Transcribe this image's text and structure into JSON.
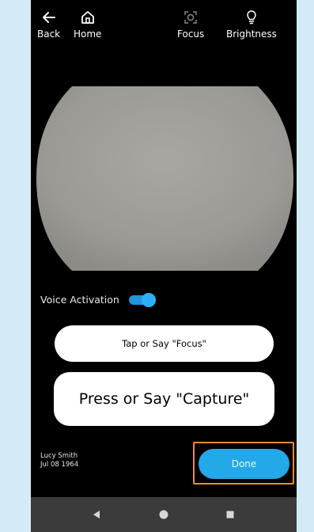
{
  "toolbar": {
    "back_label": "Back",
    "home_label": "Home",
    "focus_label": "Focus",
    "brightness_label": "Brightness"
  },
  "icons": {
    "back": "arrow-left-icon",
    "home": "home-icon",
    "focus": "focus-icon",
    "brightness": "lightbulb-icon",
    "nav_back": "triangle-back-icon",
    "nav_home": "circle-home-icon",
    "nav_recent": "square-recent-icon"
  },
  "voice_activation": {
    "label": "Voice Activation",
    "enabled": true
  },
  "buttons": {
    "focus_label": "Tap or Say \"Focus\"",
    "capture_label": "Press or Say \"Capture\"",
    "done_label": "Done"
  },
  "patient": {
    "name": "Lucy Smith",
    "dob": "Jul 08 1964"
  },
  "colors": {
    "background": "#d4ebf7",
    "accent": "#23a8e8",
    "highlight": "#f28c28",
    "screen": "#000000"
  }
}
